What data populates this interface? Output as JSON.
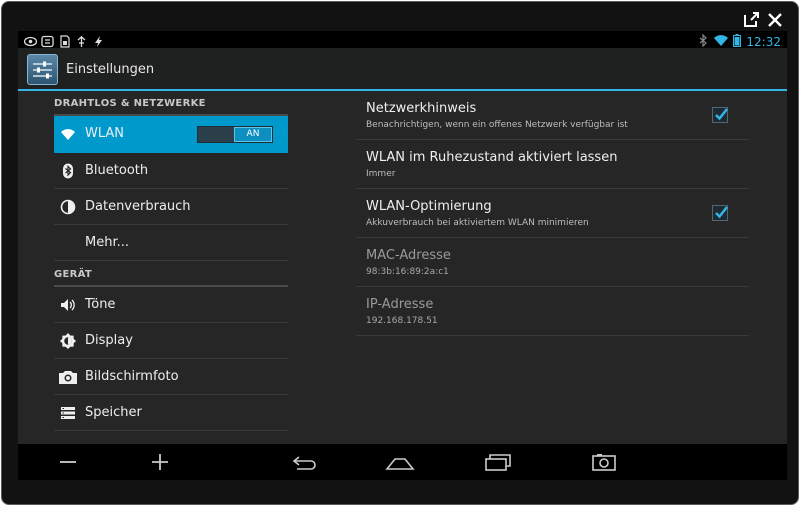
{
  "statusbar": {
    "left_icons": [
      "eye-icon",
      "sync-icon",
      "sd-card-icon",
      "usb-icon",
      "flash-icon"
    ],
    "right_icons": [
      "bluetooth-icon",
      "wifi-icon",
      "battery-icon"
    ],
    "clock": "12:32"
  },
  "actionbar": {
    "title": "Einstellungen",
    "icon": "settings-sliders-icon"
  },
  "left_pane": {
    "section1_header": "DRAHTLOS & NETZWERKE",
    "section2_header": "GERÄT",
    "items": [
      {
        "label": "WLAN",
        "icon": "wifi-icon",
        "toggle": "AN",
        "selected": true
      },
      {
        "label": "Bluetooth",
        "icon": "bluetooth-icon"
      },
      {
        "label": "Datenverbrauch",
        "icon": "data-usage-icon"
      },
      {
        "label": "Mehr..."
      },
      {
        "label": "Töne",
        "icon": "speaker-icon"
      },
      {
        "label": "Display",
        "icon": "brightness-icon"
      },
      {
        "label": "Bildschirmfoto",
        "icon": "camera-icon"
      },
      {
        "label": "Speicher",
        "icon": "storage-icon"
      }
    ]
  },
  "right_pane": {
    "items": [
      {
        "title": "Netzwerkhinweis",
        "subtitle": "Benachrichtigen, wenn ein offenes Netzwerk verfügbar ist",
        "checked": true
      },
      {
        "title": "WLAN im Ruhezustand aktiviert lassen",
        "subtitle": "Immer"
      },
      {
        "title": "WLAN-Optimierung",
        "subtitle": "Akkuverbrauch bei aktiviertem WLAN minimieren",
        "checked": true
      },
      {
        "title": "MAC-Adresse",
        "subtitle": "98:3b:16:89:2a:c1"
      },
      {
        "title": "IP-Adresse",
        "subtitle": "192.168.178.51"
      }
    ]
  },
  "navbar": {
    "buttons": [
      "volume-down-icon",
      "volume-up-icon",
      "back-icon",
      "home-icon",
      "recent-apps-icon",
      "screenshot-icon"
    ]
  },
  "window_controls": [
    "external-window-icon",
    "close-icon"
  ],
  "colors": {
    "accent": "#33b5e5",
    "selected": "#0099cc",
    "background": "#262626"
  }
}
